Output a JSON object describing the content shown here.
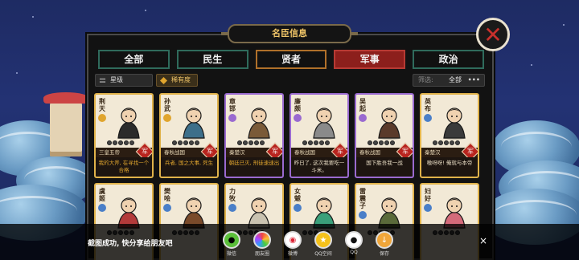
{
  "window": {
    "title": "名臣信息"
  },
  "tabs": [
    {
      "label": "全部"
    },
    {
      "label": "民生"
    },
    {
      "label": "贤者"
    },
    {
      "label": "军事"
    },
    {
      "label": "政治"
    }
  ],
  "filters": {
    "star_label": "星级",
    "rarity_label": "稀有度",
    "filter_label": "筛选:",
    "filter_value": "全部"
  },
  "cards": [
    {
      "name": "荆天",
      "era": "三皇五帝",
      "badge": "军",
      "desc": "我的大斧, 在寻找一个合格",
      "desc_color": "gold",
      "stars": 0
    },
    {
      "name": "孙武",
      "era": "春秋战国",
      "badge": "军",
      "desc": "兵者, 国之大事, 死生",
      "desc_color": "gold",
      "stars": 0
    },
    {
      "name": "章邯",
      "era": "秦楚汉",
      "badge": "军",
      "desc": "朝廷已灭, 刑徒速速出",
      "desc_color": "gold",
      "stars": 0
    },
    {
      "name": "廉颇",
      "era": "春秋战国",
      "badge": "军",
      "desc": "昨日了, 这次我要吃一斗米。",
      "desc_color": "white",
      "stars": 0
    },
    {
      "name": "吴起",
      "era": "春秋战国",
      "badge": "军",
      "desc": "国下胜吾我一战",
      "desc_color": "white",
      "stars": 0
    },
    {
      "name": "英布",
      "era": "秦楚汉",
      "badge": "军",
      "desc": "嗷呀呀! 俺就与本帝",
      "desc_color": "white",
      "stars": 0
    },
    {
      "name": "虞姬",
      "era": "",
      "badge": "",
      "desc": "",
      "desc_color": "gold",
      "stars": 0
    },
    {
      "name": "樊哙",
      "era": "",
      "badge": "",
      "desc": "",
      "desc_color": "gold",
      "stars": 0
    },
    {
      "name": "力牧",
      "era": "",
      "badge": "",
      "desc": "",
      "desc_color": "gold",
      "stars": 0
    },
    {
      "name": "女魃",
      "era": "",
      "badge": "",
      "desc": "",
      "desc_color": "gold",
      "stars": 0
    },
    {
      "name": "雷震子",
      "era": "",
      "badge": "",
      "desc": "",
      "desc_color": "gold",
      "stars": 0
    },
    {
      "name": "妇好",
      "era": "",
      "badge": "",
      "desc": "",
      "desc_color": "gold",
      "stars": 0
    }
  ],
  "share": {
    "text": "截图成功, 快分享给朋友吧",
    "close": "×",
    "buttons": [
      {
        "label": "微信",
        "icon": "wechat-icon"
      },
      {
        "label": "朋友圈",
        "icon": "moments-icon"
      },
      {
        "label": "微博",
        "icon": "weibo-icon"
      },
      {
        "label": "QQ空间",
        "icon": "qzone-icon"
      },
      {
        "label": "QQ",
        "icon": "qq-icon"
      },
      {
        "label": "保存",
        "icon": "save-icon"
      }
    ]
  },
  "colors": {
    "accent_red": "#8c1f1c",
    "gold": "#e0a52e",
    "panel": "#121212"
  }
}
